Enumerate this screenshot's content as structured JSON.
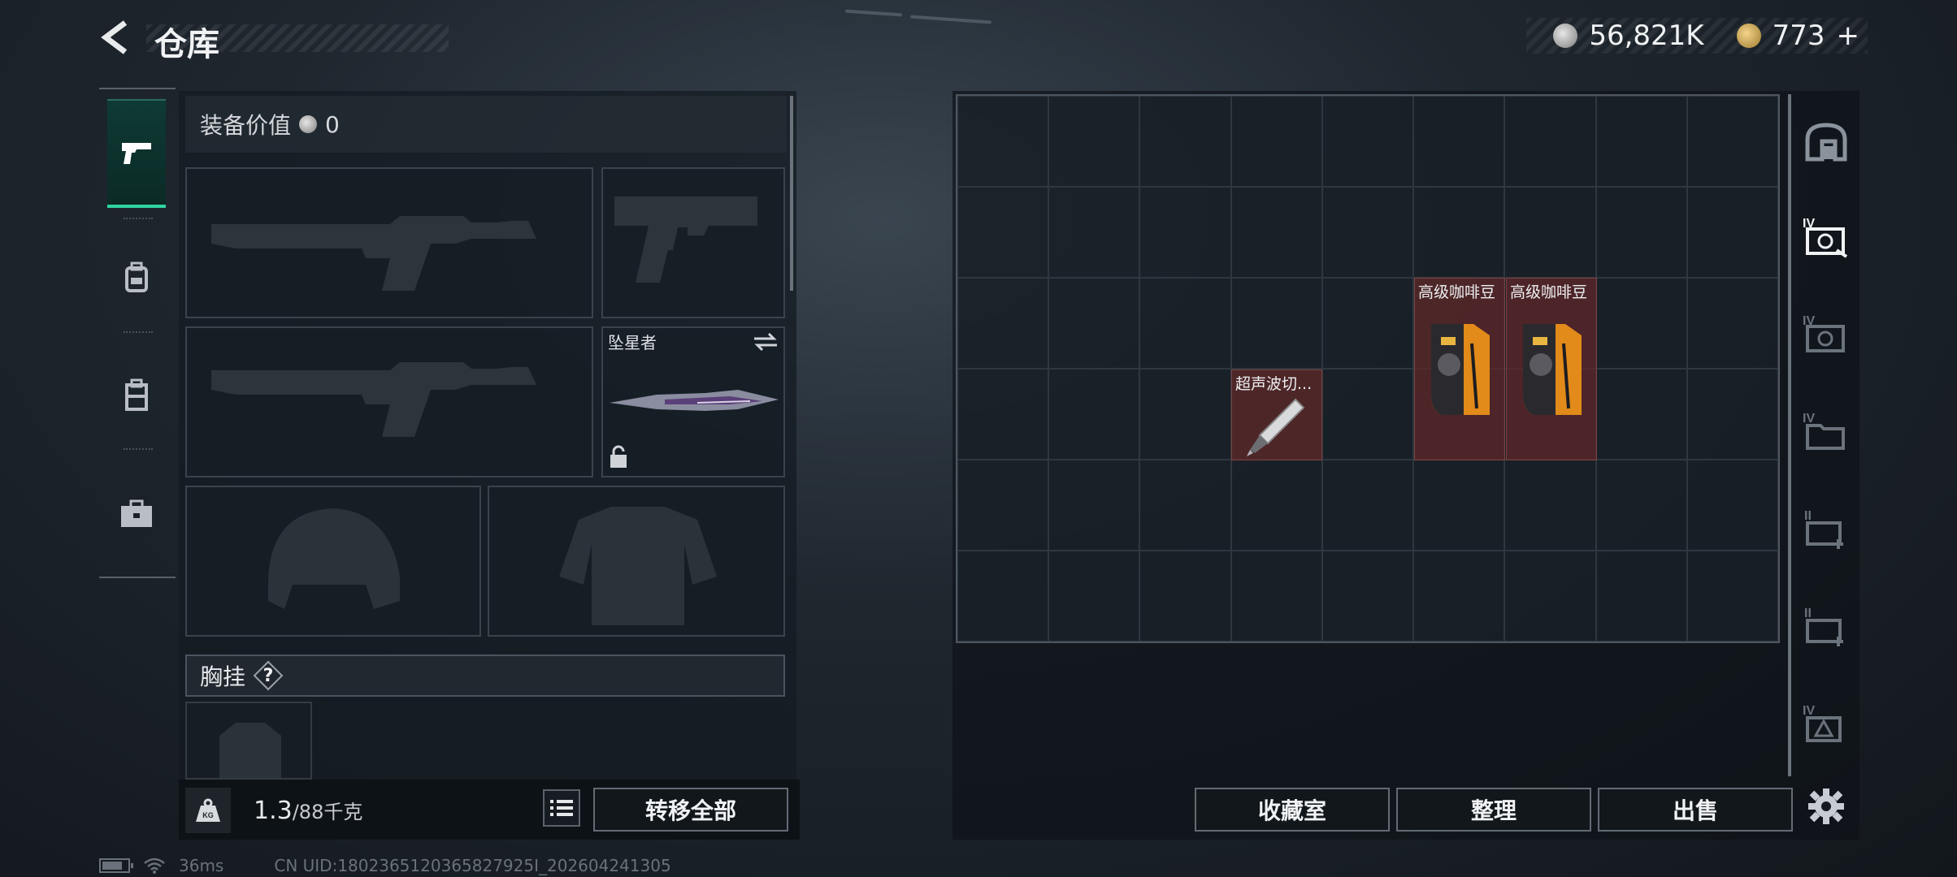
{
  "header": {
    "title": "仓库",
    "currency_silver": "56,821K",
    "currency_gold": "773",
    "currency_plus": "+"
  },
  "equipment": {
    "value_label": "装备价值",
    "value_amount": "0",
    "melee_label": "坠星者",
    "chest_label": "胸挂",
    "chest_help": "?"
  },
  "footer_left": {
    "weight_current": "1.3",
    "weight_max": "/88千克",
    "weight_icon_text": "KG",
    "transfer_all": "转移全部"
  },
  "grid": {
    "items": [
      {
        "label": "超声波切...",
        "icon": "ultrasonic-cutter-icon"
      },
      {
        "label": "高级咖啡豆",
        "icon": "coffee-bag-icon"
      },
      {
        "label": "高级咖啡豆",
        "icon": "coffee-bag-icon"
      }
    ]
  },
  "footer_right": {
    "collection": "收藏室",
    "organize": "整理",
    "sell": "出售"
  },
  "side_tabs": [
    "home-icon",
    "tier-iv-safe-icon",
    "tier-iv-safe-icon",
    "tier-iv-folder-icon",
    "tier-ii-case-icon",
    "tier-ii-case-icon",
    "tier-iv-triangle-icon",
    "settings-icon"
  ],
  "status": {
    "ping": "36ms",
    "uid": "CN UID:1802365120365827925I_202604241305"
  },
  "colors": {
    "accent_green": "#2fd4a0",
    "item_bg": "#5f282a"
  }
}
